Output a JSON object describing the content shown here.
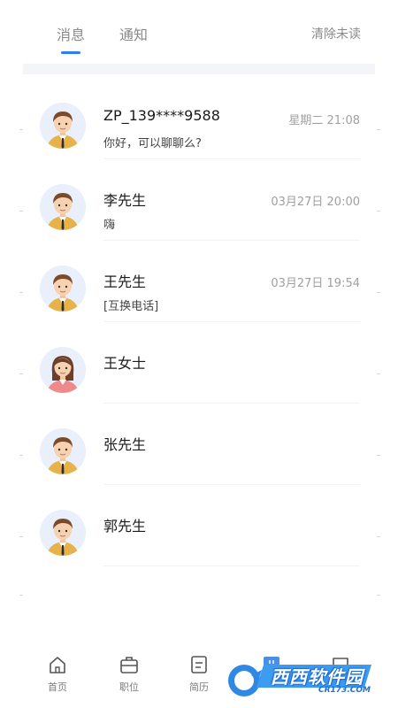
{
  "tabs": {
    "messages": "消息",
    "notifications": "通知",
    "clear_unread": "清除未读"
  },
  "colors": {
    "accent": "#2f7df6",
    "muted_text": "#8a8a8a",
    "time_text": "#a0a0a0"
  },
  "conversations": [
    {
      "name": "ZP_139****9588",
      "preview": "你好，可以聊聊么?",
      "time": "星期二 21:08",
      "avatar": "male-avatar-icon"
    },
    {
      "name": "李先生",
      "preview": "嗨",
      "time": "03月27日 20:00",
      "avatar": "male-avatar-icon"
    },
    {
      "name": "王先生",
      "preview": "[互换电话]",
      "time": "03月27日 19:54",
      "avatar": "male-avatar-icon"
    },
    {
      "name": "王女士",
      "preview": "",
      "time": "",
      "avatar": "female-avatar-icon"
    },
    {
      "name": "张先生",
      "preview": "",
      "time": "",
      "avatar": "male-avatar-icon"
    },
    {
      "name": "郭先生",
      "preview": "",
      "time": "",
      "avatar": "male-avatar-icon"
    }
  ],
  "bottom_nav": {
    "home": "首页",
    "jobs": "职位",
    "resume": "简历"
  },
  "watermark": {
    "text": "西西软件园",
    "sub": "CR173.COM"
  }
}
